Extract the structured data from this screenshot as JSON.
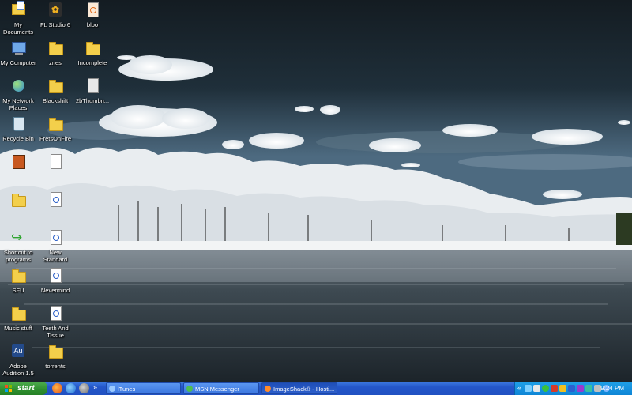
{
  "desktop": {
    "icons": [
      {
        "label": "My Documents",
        "icon": "my-documents-icon"
      },
      {
        "label": "FL Studio 6",
        "icon": "fl-studio-icon"
      },
      {
        "label": "bloo",
        "icon": "document-icon"
      },
      {
        "label": "My Computer",
        "icon": "my-computer-icon"
      },
      {
        "label": "znes",
        "icon": "folder-icon"
      },
      {
        "label": "Incomplete",
        "icon": "folder-icon"
      },
      {
        "label": "My Network Places",
        "icon": "network-places-icon"
      },
      {
        "label": "Blackshift",
        "icon": "folder-icon"
      },
      {
        "label": "2bThumbn...",
        "icon": "document-icon"
      },
      {
        "label": "Recycle Bin",
        "icon": "recycle-bin-icon"
      },
      {
        "label": "FretsOnFire",
        "icon": "folder-icon"
      },
      {
        "label": "",
        "icon": "application-icon"
      },
      {
        "label": "",
        "icon": "document-icon"
      },
      {
        "label": "",
        "icon": "folder-icon"
      },
      {
        "label": "",
        "icon": "media-file-icon"
      },
      {
        "label": "Shortcut to programs",
        "icon": "shortcut-icon"
      },
      {
        "label": "New Standard",
        "icon": "media-file-icon"
      },
      {
        "label": "SFU",
        "icon": "folder-icon"
      },
      {
        "label": "Nevermind",
        "icon": "media-file-icon"
      },
      {
        "label": "Music stuff",
        "icon": "folder-icon"
      },
      {
        "label": "Teeth And Tissue",
        "icon": "media-file-icon"
      },
      {
        "label": "Adobe Audition 1.5",
        "icon": "adobe-audition-icon"
      },
      {
        "label": "torrents",
        "icon": "folder-icon"
      }
    ]
  },
  "taskbar": {
    "start_label": "start",
    "quick_launch": [
      "firefox-icon",
      "ie-icon",
      "winamp-icon"
    ],
    "overflow_label": "»",
    "buttons": [
      {
        "label": "iTunes",
        "icon": "itunes-icon"
      },
      {
        "label": "MSN Messenger",
        "icon": "msn-icon"
      },
      {
        "label": "ImageShack® - Hosti...",
        "icon": "firefox-icon"
      }
    ],
    "tray_expand": "«",
    "tray_icons": [
      "network-icon",
      "volume-icon",
      "msn-tray-icon",
      "security-icon",
      "antivirus-icon",
      "update-icon",
      "media-icon",
      "messenger-icon",
      "display-icon",
      "bluetooth-icon",
      "itunes-tray-icon"
    ],
    "clock": "9:24 PM"
  },
  "colors": {
    "taskbar": "#2456c9",
    "start": "#2f8f2f",
    "tray": "#0f86d6",
    "sky": "#1c2b35"
  }
}
